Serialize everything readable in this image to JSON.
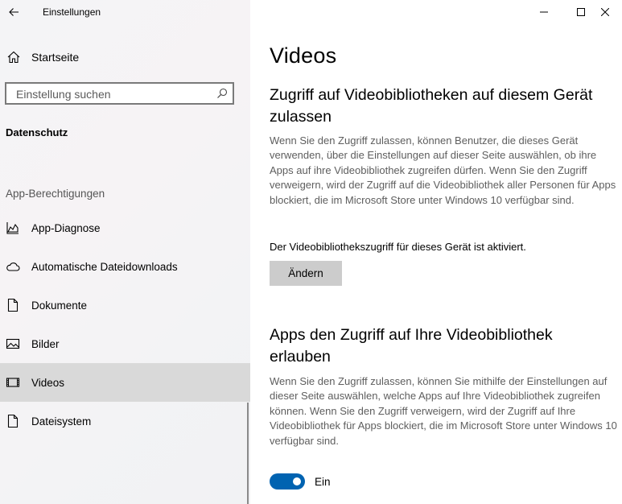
{
  "app": {
    "title": "Einstellungen"
  },
  "sidebar": {
    "home_label": "Startseite",
    "search_placeholder": "Einstellung suchen",
    "section_title": "Datenschutz",
    "group_label": "App-Berechtigungen",
    "items": [
      {
        "label": "App-Diagnose",
        "icon": "chart-icon"
      },
      {
        "label": "Automatische Dateidownloads",
        "icon": "cloud-icon"
      },
      {
        "label": "Dokumente",
        "icon": "document-icon"
      },
      {
        "label": "Bilder",
        "icon": "picture-icon"
      },
      {
        "label": "Videos",
        "icon": "video-icon",
        "active": true
      },
      {
        "label": "Dateisystem",
        "icon": "file-icon"
      }
    ]
  },
  "content": {
    "title": "Videos",
    "section1": {
      "heading": "Zugriff auf Videobibliotheken auf diesem Gerät zulassen",
      "description": "Wenn Sie den Zugriff zulassen, können Benutzer, die dieses Gerät verwenden, über die Einstellungen auf dieser Seite auswählen, ob ihre Apps auf ihre Videobibliothek zugreifen dürfen. Wenn Sie den Zugriff verweigern, wird der Zugriff auf die Videobibliothek aller Personen für Apps blockiert, die im Microsoft Store unter Windows 10 verfügbar sind.",
      "status": "Der Videobibliothekszugriff für dieses Gerät ist aktiviert.",
      "button_label": "Ändern"
    },
    "section2": {
      "heading": "Apps den Zugriff auf Ihre Videobibliothek erlauben",
      "description": "Wenn Sie den Zugriff zulassen, können Sie mithilfe der Einstellungen auf dieser Seite auswählen, welche Apps auf Ihre Videobibliothek zugreifen können. Wenn Sie den Zugriff verweigern, wird der Zugriff auf Ihre Videobibliothek für Apps blockiert, die im Microsoft Store unter Windows 10 verfügbar sind.",
      "toggle_on": true,
      "toggle_label": "Ein"
    }
  },
  "colors": {
    "accent": "#0063b1",
    "active_item": "#d9d9d9",
    "button": "#cccccc"
  }
}
